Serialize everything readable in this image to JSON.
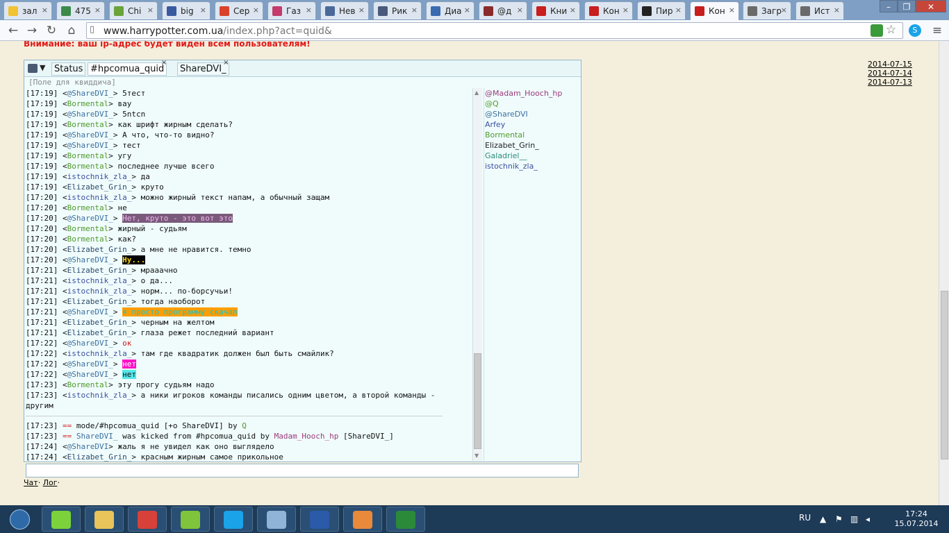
{
  "browser": {
    "tabs": [
      {
        "label": "зал",
        "icon": "yandex-icon",
        "color": "#f2c232"
      },
      {
        "label": "475",
        "icon": "image-icon",
        "color": "#3a8a4a"
      },
      {
        "label": "Chi",
        "icon": "green-logo-icon",
        "color": "#6aa33a"
      },
      {
        "label": "big",
        "icon": "user-icon",
        "color": "#3a5aa0"
      },
      {
        "label": "Сер",
        "icon": "bc-icon",
        "color": "#d9432a"
      },
      {
        "label": "Газ",
        "icon": "chart-icon",
        "color": "#c43a6a"
      },
      {
        "label": "Нев",
        "icon": "vk-icon",
        "color": "#4a6a9a"
      },
      {
        "label": "Рик",
        "icon": "book-icon",
        "color": "#4a5a7a"
      },
      {
        "label": "Диа",
        "icon": "chat-icon",
        "color": "#3a6ab0"
      },
      {
        "label": "@д",
        "icon": "at-icon",
        "color": "#8a2a2a"
      },
      {
        "label": "Кни",
        "icon": "hp-icon",
        "color": "#c81e1e"
      },
      {
        "label": "Кон",
        "icon": "hp-icon",
        "color": "#c81e1e"
      },
      {
        "label": "Пир",
        "icon": "film-icon",
        "color": "#222222"
      },
      {
        "label": "Кон",
        "icon": "hp-icon",
        "color": "#c81e1e",
        "active": true
      },
      {
        "label": "Загр",
        "icon": "download-icon",
        "color": "#6a6a6a"
      },
      {
        "label": "Ист",
        "icon": "history-icon",
        "color": "#6a6a6a"
      }
    ],
    "url_host": "www.harrypotter.com.ua",
    "url_path": "/index.php?act=quid&"
  },
  "page": {
    "warning": "Внимание: ваш ip-адрес будет виден всем пользователям!",
    "dates": [
      "2014-07-15",
      "2014-07-14",
      "2014-07-13"
    ],
    "links": [
      "Чат",
      "Лог"
    ]
  },
  "chat": {
    "tabs": [
      "Status",
      "#hpcomua_quid",
      "ShareDVI_"
    ],
    "topic": "[Поле для квиддича]",
    "messages": [
      {
        "t": "[17:19]",
        "n": "@ShareDVI_",
        "c": "nk",
        "m": "5тест"
      },
      {
        "t": "[17:19]",
        "n": "Bormental",
        "c": "nk grn",
        "m": "вау"
      },
      {
        "t": "[17:19]",
        "n": "@ShareDVI_",
        "c": "nk",
        "m": "5ntcn"
      },
      {
        "t": "[17:19]",
        "n": "Bormental",
        "c": "nk grn",
        "m": "как шрифт жирным сделать?"
      },
      {
        "t": "[17:19]",
        "n": "@ShareDVI_",
        "c": "nk",
        "m": "А что, что-то видно?"
      },
      {
        "t": "[17:19]",
        "n": "@ShareDVI_",
        "c": "nk",
        "m": "тест"
      },
      {
        "t": "[17:19]",
        "n": "Bormental",
        "c": "nk grn",
        "m": "угу"
      },
      {
        "t": "[17:19]",
        "n": "Bormental",
        "c": "nk grn",
        "m": "последнее лучше всего"
      },
      {
        "t": "[17:19]",
        "n": "istochnik_zla_",
        "c": "nk blu",
        "m": "да"
      },
      {
        "t": "[17:19]",
        "n": "Elizabet_Grin_",
        "c": "nk dk",
        "m": "круто"
      },
      {
        "t": "[17:20]",
        "n": "istochnik_zla_",
        "c": "nk blu",
        "m": "можно жирный текст напам, а обычный защам"
      },
      {
        "t": "[17:20]",
        "n": "Bormental",
        "c": "nk grn",
        "m": "не"
      },
      {
        "t": "[17:20]",
        "n": "@ShareDVI_",
        "c": "nk",
        "m": "Нет, круто - это вот это",
        "h": "hl-purple"
      },
      {
        "t": "[17:20]",
        "n": "Bormental",
        "c": "nk grn",
        "m": "жирный - судьям"
      },
      {
        "t": "[17:20]",
        "n": "Bormental",
        "c": "nk grn",
        "m": "как?"
      },
      {
        "t": "[17:20]",
        "n": "Elizabet_Grin_",
        "c": "nk dk",
        "m": "а мне не нравится. темно"
      },
      {
        "t": "[17:20]",
        "n": "@ShareDVI_",
        "c": "nk",
        "m": "Ну...",
        "h": "hl-yellow"
      },
      {
        "t": "[17:21]",
        "n": "Elizabet_Grin_",
        "c": "nk dk",
        "m": "мрааачно"
      },
      {
        "t": "[17:21]",
        "n": "istochnik_zla_",
        "c": "nk blu",
        "m": "о да..."
      },
      {
        "t": "[17:21]",
        "n": "istochnik_zla_",
        "c": "nk blu",
        "m": "норм... по-борсучьи!"
      },
      {
        "t": "[17:21]",
        "n": "Elizabet_Grin_",
        "c": "nk dk",
        "m": "тогда наоборот"
      },
      {
        "t": "[17:21]",
        "n": "@ShareDVI_",
        "c": "nk",
        "m": "я просто программу скачал",
        "h": "hl-orange"
      },
      {
        "t": "[17:21]",
        "n": "Elizabet_Grin_",
        "c": "nk dk",
        "m": "черным на желтом"
      },
      {
        "t": "[17:21]",
        "n": "Elizabet_Grin_",
        "c": "nk dk",
        "m": "глаза режет последний вариант"
      },
      {
        "t": "[17:22]",
        "n": "@ShareDVI_",
        "c": "nk",
        "m": "ок",
        "h": "red"
      },
      {
        "t": "[17:22]",
        "n": "istochnik_zla_",
        "c": "nk blu",
        "m": "там где квадратик должен был быть смайлик?"
      },
      {
        "t": "[17:22]",
        "n": "@ShareDVI_",
        "c": "nk",
        "m": "нет",
        "h": "hl-magenta"
      },
      {
        "t": "[17:22]",
        "n": "@ShareDVI_",
        "c": "nk",
        "m": "нет",
        "h": "hl-cyan"
      },
      {
        "t": "[17:23]",
        "n": "Bormental",
        "c": "nk grn",
        "m": "эту прогу судьям надо"
      },
      {
        "t": "[17:23]",
        "n": "istochnik_zla_",
        "c": "nk blu",
        "m": "а ники игроков команды писались одним цветом, а второй команды -"
      },
      {
        "t": "",
        "n": "",
        "c": "",
        "m": "другим",
        "cont": true
      }
    ],
    "events": [
      {
        "t": "[17:23]",
        "op": "==",
        "a": "mode/#hpcomua_quid [+o ShareDVI] by",
        "who": "Q",
        "whoc": "mod",
        "b": ""
      },
      {
        "t": "[17:23]",
        "op": "==",
        "a": "",
        "kicked": "ShareDVI_",
        "mid": "was kicked from #hpcomua_quid by",
        "who": "Madam_Hooch_hp",
        "whoc": "pur",
        "b": "[ShareDVI_]"
      }
    ],
    "after": [
      {
        "t": "[17:24]",
        "n": "@ShareDVI",
        "c": "nk",
        "m": "жаль я не увидел как оно выглядело"
      },
      {
        "t": "[17:24]",
        "n": "Elizabet_Grin_",
        "c": "nk dk",
        "m": "красным жирным самое прикольное"
      }
    ],
    "nicklist": [
      {
        "n": "@Madam_Hooch_hp",
        "color": "#9b3a7a"
      },
      {
        "n": "@Q",
        "color": "#4e9a2a"
      },
      {
        "n": "@ShareDVI",
        "color": "#3b6fa0"
      },
      {
        "n": "Arfey",
        "color": "#3b4fa0"
      },
      {
        "n": "Bormental",
        "color": "#4e9a2a"
      },
      {
        "n": "Elizabet_Grin_",
        "color": "#222222"
      },
      {
        "n": "Galadriel__",
        "color": "#2a8a7a"
      },
      {
        "n": "istochnik_zla_",
        "color": "#3b4fa0"
      }
    ]
  },
  "taskbar": {
    "lang": "RU",
    "time": "17:24",
    "date": "15.07.2014",
    "apps": [
      {
        "name": "icq-icon",
        "color": "#7cd23a"
      },
      {
        "name": "file-explorer-icon",
        "color": "#e8c45a"
      },
      {
        "name": "chrome-icon",
        "color": "#d8413a"
      },
      {
        "name": "utorrent-icon",
        "color": "#7fc43a"
      },
      {
        "name": "skype-icon",
        "color": "#1aa3e8"
      },
      {
        "name": "notepad-icon",
        "color": "#8fb4d8"
      },
      {
        "name": "word-icon",
        "color": "#2a5aa8"
      },
      {
        "name": "media-player-icon",
        "color": "#e88a3a"
      },
      {
        "name": "excel-icon",
        "color": "#2a8a3a"
      }
    ]
  }
}
